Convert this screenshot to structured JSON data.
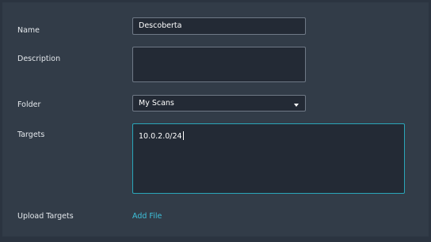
{
  "form": {
    "name": {
      "label": "Name",
      "value": "Descoberta"
    },
    "description": {
      "label": "Description",
      "value": ""
    },
    "folder": {
      "label": "Folder",
      "selected": "My Scans"
    },
    "targets": {
      "label": "Targets",
      "value": "10.0.2.0/24"
    },
    "upload_targets": {
      "label": "Upload Targets",
      "link": "Add File"
    }
  },
  "colors": {
    "panel_background": "#323c48",
    "field_background": "#232a35",
    "field_border": "#6f7986",
    "focus_border": "#2aa6b9",
    "link": "#3ec1da"
  },
  "icons": {
    "folder_dropdown": "caret-down-icon"
  }
}
